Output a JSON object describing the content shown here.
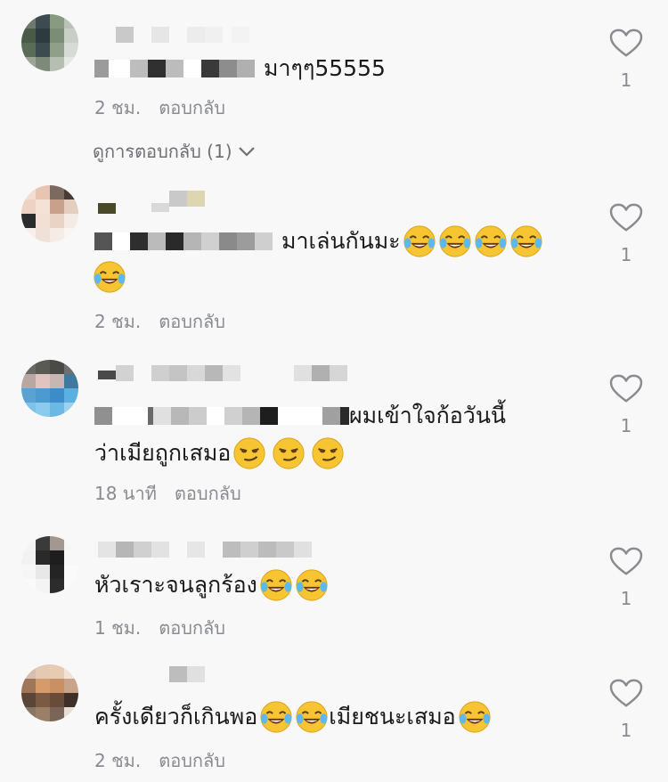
{
  "comments": [
    {
      "text": "มาๆๆ55555",
      "time": "2 ชม.",
      "reply": "ตอบกลับ",
      "likes": "1",
      "view_replies": "ดูการตอบกลับ (1)",
      "emoji_count": 0
    },
    {
      "text": "มาเล่นกันมะ",
      "time": "2 ชม.",
      "reply": "ตอบกลับ",
      "likes": "1",
      "emoji_count": 5,
      "emoji_type": "laughing-tears-emoji"
    },
    {
      "text": "ผมเข้าใจก้อวันนี้",
      "text2": "ว่าเมียถูกเสมอ",
      "time": "18 นาที",
      "reply": "ตอบกลับ",
      "likes": "1",
      "emoji_count": 3,
      "emoji_type": "smirk-emoji"
    },
    {
      "text": "หัวเราะจนลูกร้อง",
      "time": "1 ชม.",
      "reply": "ตอบกลับ",
      "likes": "1",
      "emoji_count": 2,
      "emoji_type": "laughing-tears-emoji"
    },
    {
      "text": "ครั้งเดียวก็เกินพอ",
      "text2": "เมียชนะเสมอ",
      "time": "2 ชม.",
      "reply": "ตอบกลับ",
      "likes": "1",
      "emoji_count": 3,
      "emoji_type": "laughing-tears-emoji"
    }
  ],
  "colors": {
    "background": "#f8f8f8",
    "meta_text": "#8a8b91",
    "emoji_yellow": "#f7c531"
  }
}
